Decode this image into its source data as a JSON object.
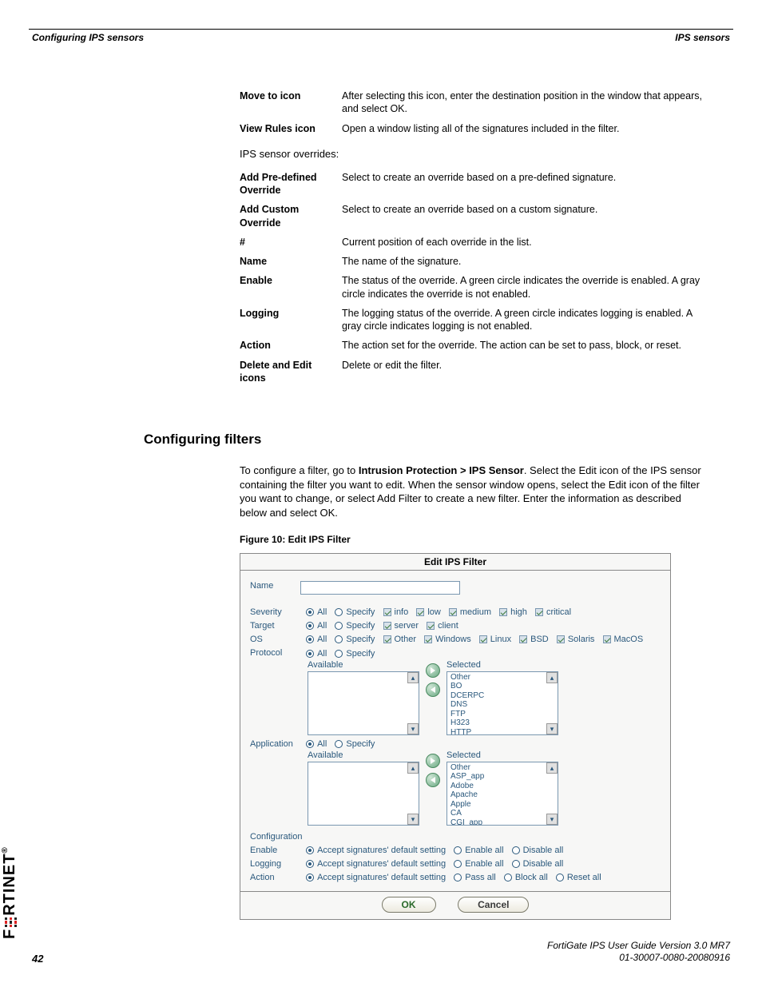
{
  "header": {
    "left": "Configuring IPS sensors",
    "right": "IPS sensors"
  },
  "defs1": [
    {
      "term": "Move to icon",
      "desc": "After selecting this icon, enter the destination position in the window that appears, and select OK."
    },
    {
      "term": "View Rules icon",
      "desc": "Open a window listing all of the signatures included in the filter."
    }
  ],
  "overrides_intro": "IPS sensor overrides:",
  "defs2": [
    {
      "term": "Add Pre-defined Override",
      "desc": "Select to create an override based on a pre-defined signature."
    },
    {
      "term": "Add Custom Override",
      "desc": "Select to create an override based on a custom signature."
    },
    {
      "term": "#",
      "desc": "Current position of each override in the list."
    },
    {
      "term": "Name",
      "desc": "The name of the signature."
    },
    {
      "term": "Enable",
      "desc": "The status of the override. A green circle indicates the override is enabled. A gray circle indicates the override is not enabled."
    },
    {
      "term": "Logging",
      "desc": "The logging status of the override. A green circle indicates logging is enabled. A gray circle indicates logging is not enabled."
    },
    {
      "term": "Action",
      "desc": "The action set for the override. The action can be set to pass, block, or reset."
    },
    {
      "term": "Delete and Edit icons",
      "desc": "Delete or edit the filter."
    }
  ],
  "section_title": "Configuring filters",
  "paragraph": {
    "pre": "To configure a filter, go to ",
    "bold": "Intrusion Protection > IPS Sensor",
    "post": ". Select the Edit icon of the IPS sensor containing the filter you want to edit. When the sensor window opens, select the Edit icon of the filter you want to change, or select Add Filter to create a new filter. Enter the information as described below and select OK."
  },
  "figure_caption": "Figure 10: Edit IPS Filter",
  "panel": {
    "title": "Edit IPS Filter",
    "name_label": "Name",
    "rows": {
      "severity": {
        "label": "Severity",
        "all": "All",
        "specify": "Specify",
        "opts": [
          "info",
          "low",
          "medium",
          "high",
          "critical"
        ]
      },
      "target": {
        "label": "Target",
        "all": "All",
        "specify": "Specify",
        "opts": [
          "server",
          "client"
        ]
      },
      "os": {
        "label": "OS",
        "all": "All",
        "specify": "Specify",
        "opts": [
          "Other",
          "Windows",
          "Linux",
          "BSD",
          "Solaris",
          "MacOS"
        ]
      },
      "protocol": {
        "label": "Protocol",
        "all": "All",
        "specify": "Specify",
        "available": "Available",
        "selected": "Selected",
        "selected_items": [
          "Other",
          "BO",
          "DCERPC",
          "DNS",
          "FTP",
          "H323",
          "HTTP"
        ]
      },
      "application": {
        "label": "Application",
        "all": "All",
        "specify": "Specify",
        "available": "Available",
        "selected": "Selected",
        "selected_items": [
          "Other",
          "ASP_app",
          "Adobe",
          "Apache",
          "Apple",
          "CA",
          "CGI_app"
        ]
      }
    },
    "config": {
      "head": "Configuration",
      "enable": {
        "label": "Enable",
        "o1": "Accept signatures' default setting",
        "o2": "Enable all",
        "o3": "Disable all"
      },
      "logging": {
        "label": "Logging",
        "o1": "Accept signatures' default setting",
        "o2": "Enable all",
        "o3": "Disable all"
      },
      "action": {
        "label": "Action",
        "o1": "Accept signatures' default setting",
        "o2": "Pass all",
        "o3": "Block all",
        "o4": "Reset all"
      }
    },
    "ok": "OK",
    "cancel": "Cancel"
  },
  "logo_text": {
    "pre": "F",
    "post": "RTINET"
  },
  "footer": {
    "line1": "FortiGate IPS User Guide Version 3.0 MR7",
    "line2": "01-30007-0080-20080916",
    "page": "42"
  }
}
